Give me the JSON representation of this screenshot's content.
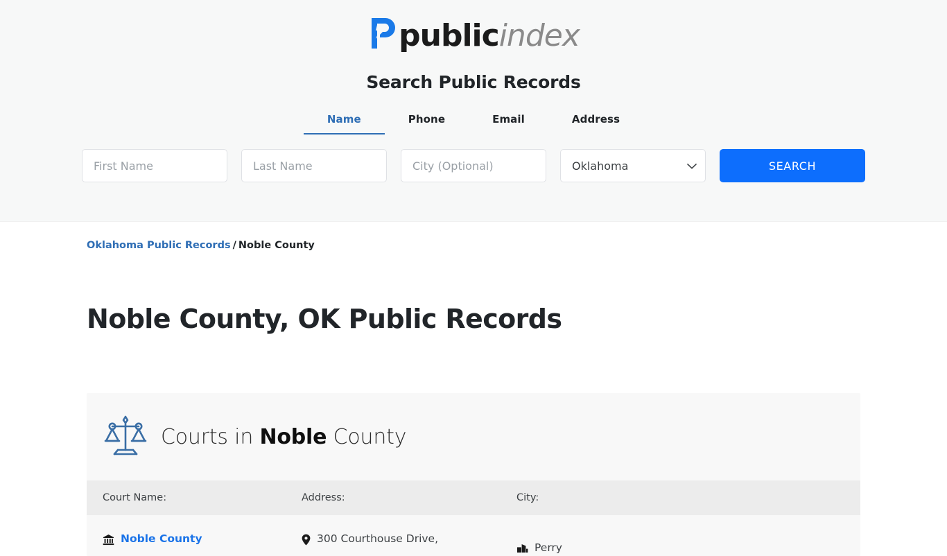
{
  "brand": {
    "name_bold": "public",
    "name_italic": "index",
    "logo_icon": "publicindex-p-logo",
    "accent_blue": "#1a7ae8",
    "text_dark": "#1b1b1b",
    "text_gray": "#8a8a8a"
  },
  "search": {
    "title": "Search Public Records",
    "tabs": [
      {
        "label": "Name",
        "active": true
      },
      {
        "label": "Phone",
        "active": false
      },
      {
        "label": "Email",
        "active": false
      },
      {
        "label": "Address",
        "active": false
      }
    ],
    "fields": {
      "first_name_placeholder": "First Name",
      "first_name_value": "",
      "last_name_placeholder": "Last Name",
      "last_name_value": "",
      "city_placeholder": "City (Optional)",
      "city_value": "",
      "state_selected": "Oklahoma"
    },
    "submit_label": "SEARCH",
    "submit_color": "#0d6efd",
    "active_tab_color": "#2f6eb5"
  },
  "breadcrumb": {
    "parent_label": "Oklahoma Public Records",
    "separator": "/",
    "current_label": "Noble County"
  },
  "page": {
    "title": "Noble County, OK Public Records"
  },
  "courts_card": {
    "icon": "scales-of-justice-icon",
    "icon_color": "#3a6ea5",
    "heading_prefix": "Courts in ",
    "heading_highlight": "Noble",
    "heading_suffix": " County",
    "columns": [
      "Court Name:",
      "Address:",
      "City:"
    ],
    "rows": [
      {
        "court_name": "Noble County",
        "court_name_icon": "courthouse-icon",
        "address": "300 Courthouse Drive,",
        "address_icon": "map-pin-icon",
        "city": "Perry",
        "city_icon": "city-building-icon"
      }
    ]
  }
}
